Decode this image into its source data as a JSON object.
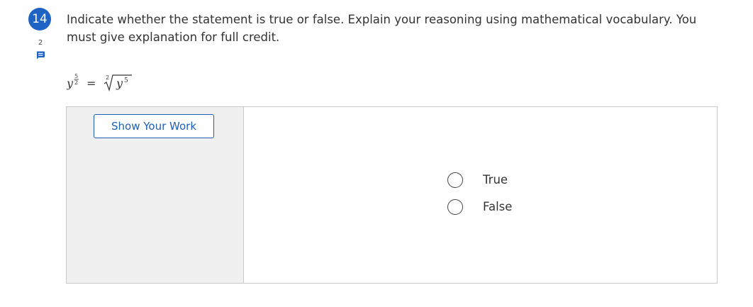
{
  "question": {
    "number": "14",
    "comment_count": "2",
    "comment_icon": "comment-icon",
    "prompt": "Indicate whether the statement is true or false.  Explain your reasoning using mathematical vocabulary. You must give explanation for full credit.",
    "equation": {
      "base_left": "y",
      "exp_numerator": "5",
      "exp_denominator": "2",
      "equals": "=",
      "root_index": "2",
      "radicand_base": "y",
      "radicand_exponent": "5"
    }
  },
  "work_panel": {
    "show_work_label": "Show Your Work"
  },
  "choices": [
    {
      "label": "True",
      "selected": false
    },
    {
      "label": "False",
      "selected": false
    }
  ],
  "colors": {
    "accent": "#1f63c4",
    "button_border": "#1f5fb3",
    "panel_bg": "#f0f0f0",
    "border": "#c8c8c8"
  }
}
